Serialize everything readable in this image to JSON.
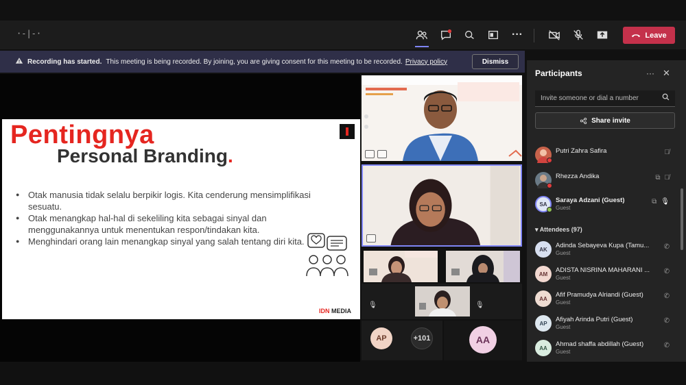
{
  "toolbar": {
    "dial_display": "·-|-·",
    "leave_label": "Leave"
  },
  "banner": {
    "bold": "Recording has started.",
    "text": "This meeting is being recorded. By joining, you are giving consent for this meeting to be recorded.",
    "privacy_link": "Privacy policy",
    "dismiss_label": "Dismiss"
  },
  "slide": {
    "title_line1": "Pentingnya",
    "title_line2": "Personal Branding",
    "title_dot": ".",
    "bullets": [
      "Otak manusia tidak selalu berpikir logis. Kita cenderung mensimplifikasi sesuatu.",
      "Otak menangkap hal-hal di sekeliling kita sebagai sinyal dan menggunakannya untuk menentukan respon/tindakan kita.",
      "Menghindari orang lain menangkap sinyal yang salah tentang diri kita."
    ],
    "logo_idn": "IDN",
    "logo_media": "MEDIA"
  },
  "tiles": {
    "avatar_ap": "AP",
    "more_count": "+101",
    "avatar_aa": "AA"
  },
  "participants": {
    "title": "Participants",
    "invite_placeholder": "Invite someone or dial a number",
    "share_invite": "Share invite",
    "attendees_label": "Attendees (97)",
    "presenters": [
      {
        "name": "Putri Zahra Safira",
        "initials": "",
        "color": "#c8634b"
      },
      {
        "name": "Rhezza Andika",
        "initials": "",
        "color": "#6a7a86"
      },
      {
        "name": "Saraya Adzani (Guest)",
        "initials": "SA",
        "sub": "Guest",
        "color": "#dfe6f5"
      }
    ],
    "attendees": [
      {
        "name": "Adinda Sebayeva Kupa (Tamu...",
        "initials": "AK",
        "sub": "Guest",
        "color": "#d7dff0"
      },
      {
        "name": "ADISTA NISRINA MAHARANI ...",
        "initials": "AM",
        "sub": "Guest",
        "color": "#f2d8d0"
      },
      {
        "name": "Afif Pramudya Alriandi (Guest)",
        "initials": "AA",
        "sub": "Guest",
        "color": "#eedcd2"
      },
      {
        "name": "Afiyah Arinda Putri (Guest)",
        "initials": "AP",
        "sub": "Guest",
        "color": "#dde7ef"
      },
      {
        "name": "Ahmad shaffa abdillah (Guest)",
        "initials": "AA",
        "sub": "Guest",
        "color": "#d9ecdf"
      }
    ]
  }
}
